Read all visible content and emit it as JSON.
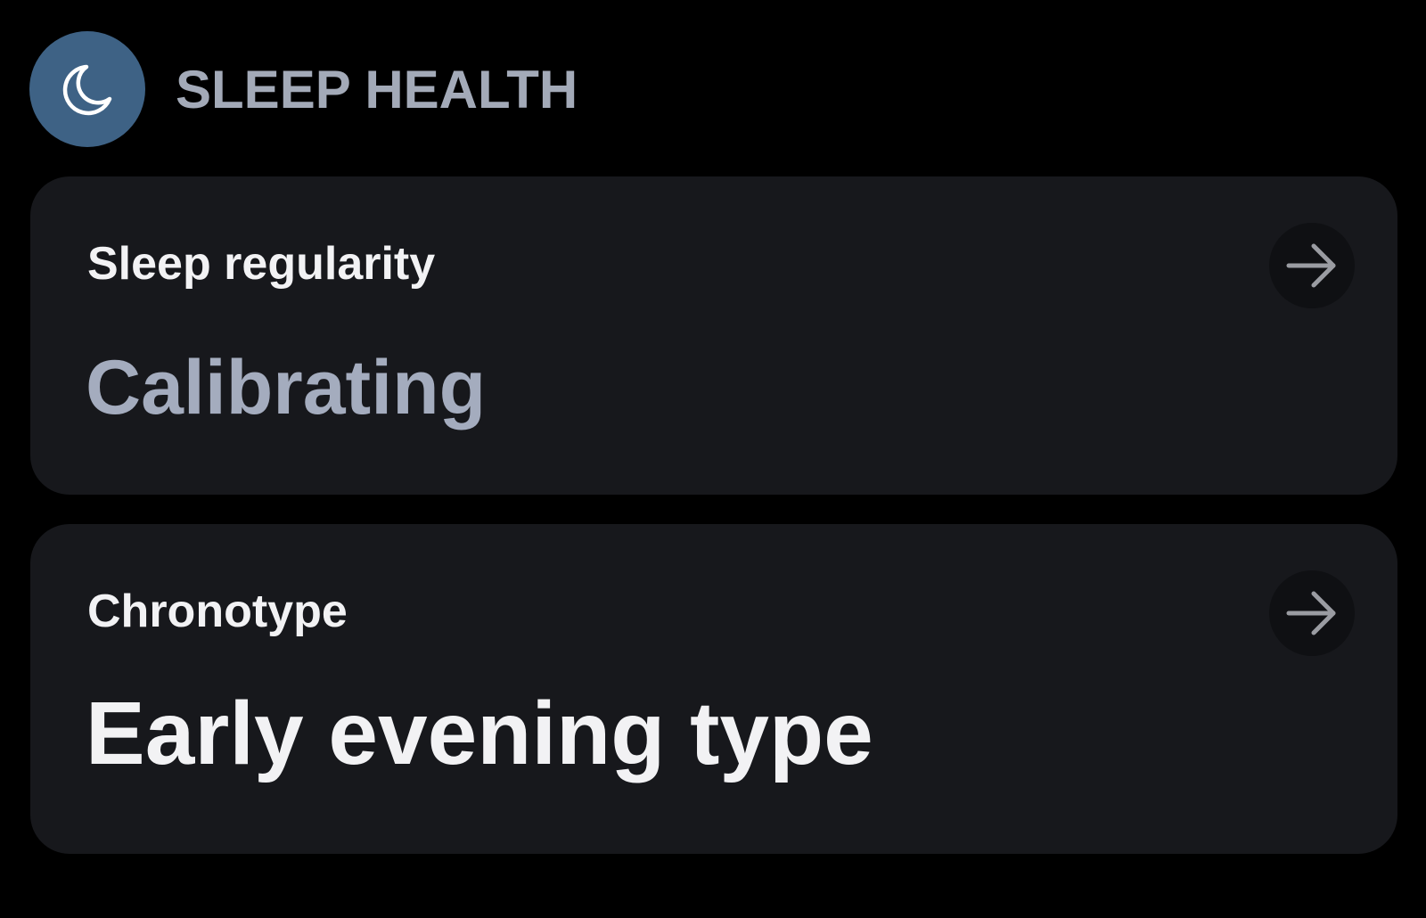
{
  "header": {
    "title": "SLEEP HEALTH",
    "icon": "moon-icon",
    "badge_color": "#3e6285"
  },
  "cards": [
    {
      "label": "Sleep regularity",
      "value": "Calibrating",
      "value_color": "#a4acbe",
      "action_icon": "arrow-right-icon"
    },
    {
      "label": "Chronotype",
      "value": "Early evening type",
      "value_color": "#f2f2f4",
      "action_icon": "arrow-right-icon"
    }
  ]
}
